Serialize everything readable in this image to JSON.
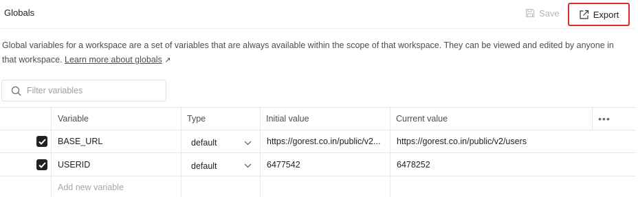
{
  "header": {
    "title": "Globals",
    "save_label": "Save",
    "export_label": "Export"
  },
  "description": {
    "text": "Global variables for a workspace are a set of variables that are always available within the scope of that workspace. They can be viewed and edited by anyone in that workspace.",
    "link_text": "Learn more about globals",
    "link_arrow": "↗"
  },
  "filter": {
    "placeholder": "Filter variables"
  },
  "table": {
    "headers": {
      "variable": "Variable",
      "type": "Type",
      "initial": "Initial value",
      "current": "Current value",
      "more": "•••"
    },
    "rows": [
      {
        "checked": true,
        "variable": "BASE_URL",
        "type": "default",
        "initial": "https://gorest.co.in/public/v2...",
        "current": "https://gorest.co.in/public/v2/users"
      },
      {
        "checked": true,
        "variable": "USERID",
        "type": "default",
        "initial": "6477542",
        "current": "6478252"
      }
    ],
    "new_row_placeholder": "Add new variable"
  },
  "colors": {
    "accent_highlight": "#e3262a",
    "text": "#212121",
    "muted": "#9e9e9e",
    "border": "#e6e6e6"
  },
  "icons": {
    "save": "save-icon",
    "export": "export-icon",
    "search": "search-icon",
    "checkbox": "checkbox-checked-icon",
    "chevron": "chevron-down-icon",
    "more": "more-horizontal-icon"
  }
}
